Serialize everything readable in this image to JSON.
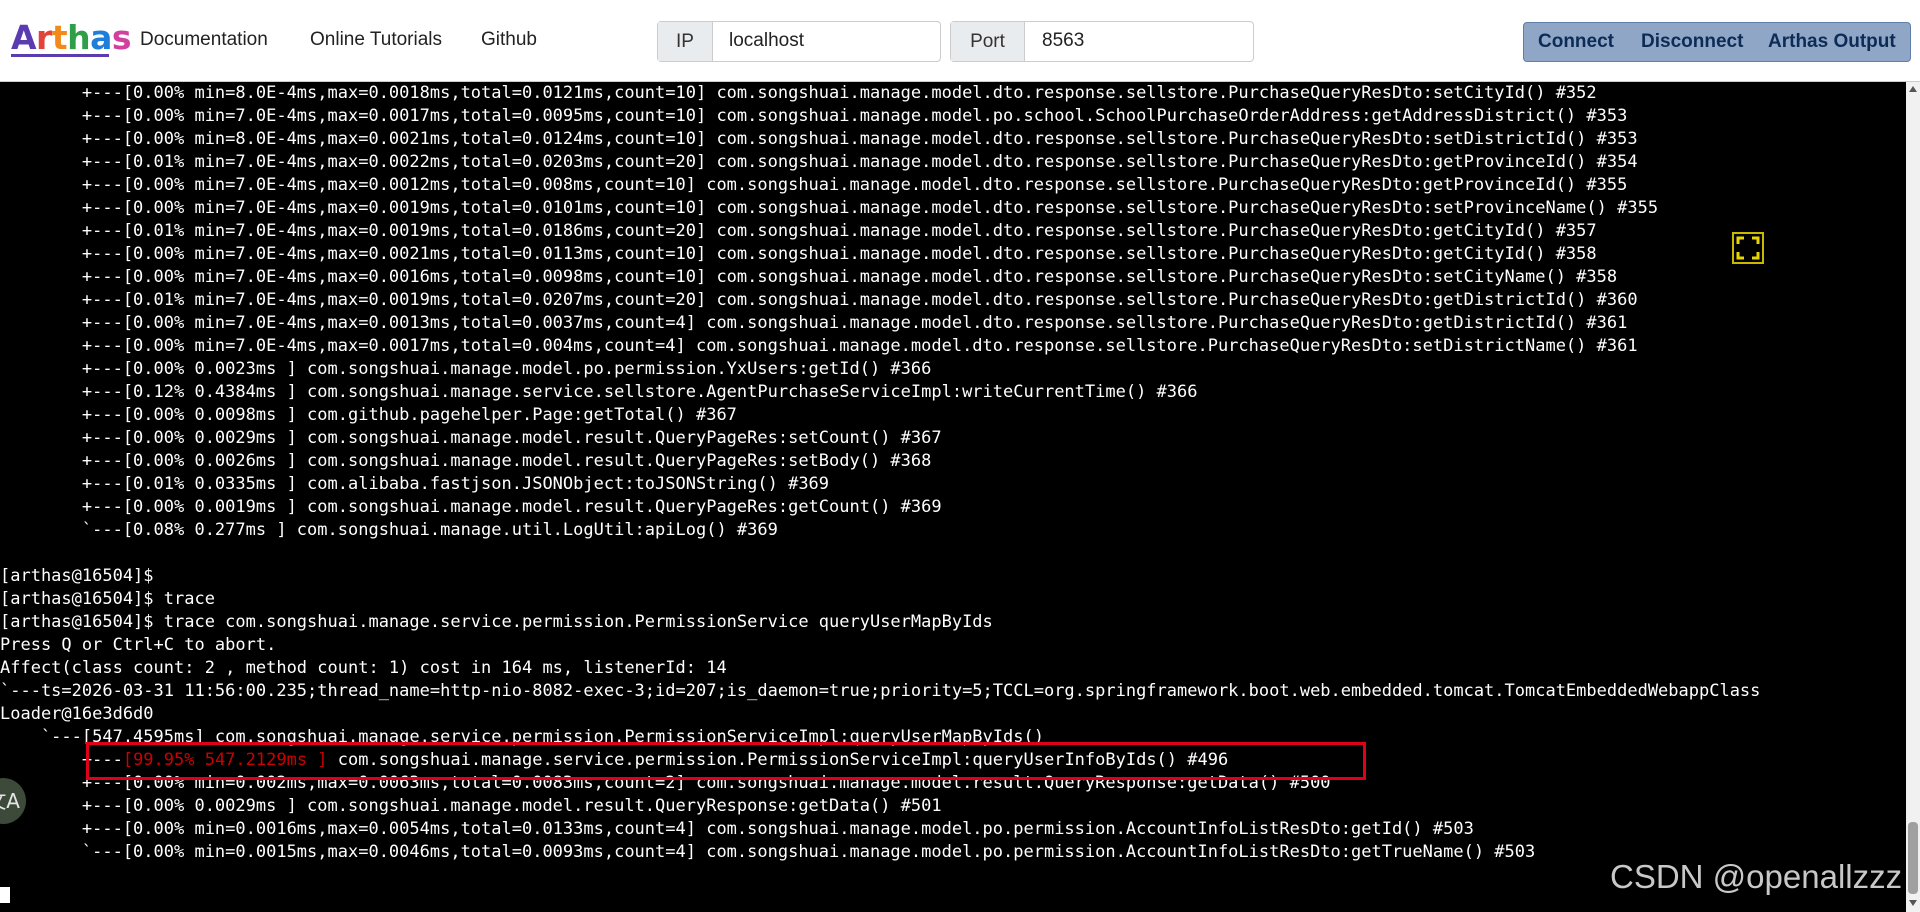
{
  "header": {
    "logo_letters": [
      "A",
      "r",
      "t",
      "h",
      "a",
      "s"
    ],
    "logo_colors": [
      "#5b3bb0",
      "#e2433a",
      "#f28a1b",
      "#2e9e49",
      "#1f7fd8",
      "#d13fa0"
    ],
    "nav": [
      "Documentation",
      "Online Tutorials",
      "Github"
    ],
    "ip_label": "IP",
    "ip_value": "localhost",
    "port_label": "Port",
    "port_value": "8563",
    "buttons": [
      "Connect",
      "Disconnect",
      "Arthas Output"
    ]
  },
  "terminal": {
    "lines": [
      "        +---[0.00% min=8.0E-4ms,max=0.0018ms,total=0.0121ms,count=10] com.songshuai.manage.model.dto.response.sellstore.PurchaseQueryResDto:setCityId() #352",
      "        +---[0.00% min=7.0E-4ms,max=0.0017ms,total=0.0095ms,count=10] com.songshuai.manage.model.po.school.SchoolPurchaseOrderAddress:getAddressDistrict() #353",
      "        +---[0.00% min=8.0E-4ms,max=0.0021ms,total=0.0124ms,count=10] com.songshuai.manage.model.dto.response.sellstore.PurchaseQueryResDto:setDistrictId() #353",
      "        +---[0.01% min=7.0E-4ms,max=0.0022ms,total=0.0203ms,count=20] com.songshuai.manage.model.dto.response.sellstore.PurchaseQueryResDto:getProvinceId() #354",
      "        +---[0.00% min=7.0E-4ms,max=0.0012ms,total=0.008ms,count=10] com.songshuai.manage.model.dto.response.sellstore.PurchaseQueryResDto:getProvinceId() #355",
      "        +---[0.00% min=7.0E-4ms,max=0.0019ms,total=0.0101ms,count=10] com.songshuai.manage.model.dto.response.sellstore.PurchaseQueryResDto:setProvinceName() #355",
      "        +---[0.01% min=7.0E-4ms,max=0.0019ms,total=0.0186ms,count=20] com.songshuai.manage.model.dto.response.sellstore.PurchaseQueryResDto:getCityId() #357",
      "        +---[0.00% min=7.0E-4ms,max=0.0021ms,total=0.0113ms,count=10] com.songshuai.manage.model.dto.response.sellstore.PurchaseQueryResDto:getCityId() #358",
      "        +---[0.00% min=7.0E-4ms,max=0.0016ms,total=0.0098ms,count=10] com.songshuai.manage.model.dto.response.sellstore.PurchaseQueryResDto:setCityName() #358",
      "        +---[0.01% min=7.0E-4ms,max=0.0019ms,total=0.0207ms,count=20] com.songshuai.manage.model.dto.response.sellstore.PurchaseQueryResDto:getDistrictId() #360",
      "        +---[0.00% min=7.0E-4ms,max=0.0013ms,total=0.0037ms,count=4] com.songshuai.manage.model.dto.response.sellstore.PurchaseQueryResDto:getDistrictId() #361",
      "        +---[0.00% min=7.0E-4ms,max=0.0017ms,total=0.004ms,count=4] com.songshuai.manage.model.dto.response.sellstore.PurchaseQueryResDto:setDistrictName() #361",
      "        +---[0.00% 0.0023ms ] com.songshuai.manage.model.po.permission.YxUsers:getId() #366",
      "        +---[0.12% 0.4384ms ] com.songshuai.manage.service.sellstore.AgentPurchaseServiceImpl:writeCurrentTime() #366",
      "        +---[0.00% 0.0098ms ] com.github.pagehelper.Page:getTotal() #367",
      "        +---[0.00% 0.0029ms ] com.songshuai.manage.model.result.QueryPageRes:setCount() #367",
      "        +---[0.00% 0.0026ms ] com.songshuai.manage.model.result.QueryPageRes:setBody() #368",
      "        +---[0.01% 0.0335ms ] com.alibaba.fastjson.JSONObject:toJSONString() #369",
      "        +---[0.00% 0.0019ms ] com.songshuai.manage.model.result.QueryPageRes:getCount() #369",
      "        `---[0.08% 0.277ms ] com.songshuai.manage.util.LogUtil:apiLog() #369",
      "",
      "[arthas@16504]$",
      "[arthas@16504]$ trace",
      "[arthas@16504]$ trace com.songshuai.manage.service.permission.PermissionService queryUserMapByIds",
      "Press Q or Ctrl+C to abort.",
      "Affect(class count: 2 , method count: 1) cost in 164 ms, listenerId: 14",
      "`---ts=2026-03-31 11:56:00.235;thread_name=http-nio-8082-exec-3;id=207;is_daemon=true;priority=5;TCCL=org.springframework.boot.web.embedded.tomcat.TomcatEmbeddedWebappClass",
      "Loader@16e3d6d0",
      "    `---[547.4595ms] com.songshuai.manage.service.permission.PermissionServiceImpl:queryUserMapByIds()"
    ],
    "highlight_prefix": "        +---",
    "highlight_red": "[99.95% 547.2129ms ]",
    "highlight_rest": " com.songshuai.manage.service.permission.PermissionServiceImpl:queryUserInfoByIds() #496",
    "after_lines": [
      "        +---[0.00% min=0.002ms,max=0.0063ms,total=0.0083ms,count=2] com.songshuai.manage.model.result.QueryResponse:getData() #500",
      "        +---[0.00% 0.0029ms ] com.songshuai.manage.model.result.QueryResponse:getData() #501",
      "        +---[0.00% min=0.0016ms,max=0.0054ms,total=0.0133ms,count=4] com.songshuai.manage.model.po.permission.AccountInfoListResDto:getId() #503",
      "        `---[0.00% min=0.0015ms,max=0.0046ms,total=0.0093ms,count=4] com.songshuai.manage.model.po.permission.AccountInfoListResDto:getTrueName() #503"
    ]
  },
  "overlay": {
    "translate_glyph": "文A",
    "watermark": "CSDN @openallzzz"
  }
}
